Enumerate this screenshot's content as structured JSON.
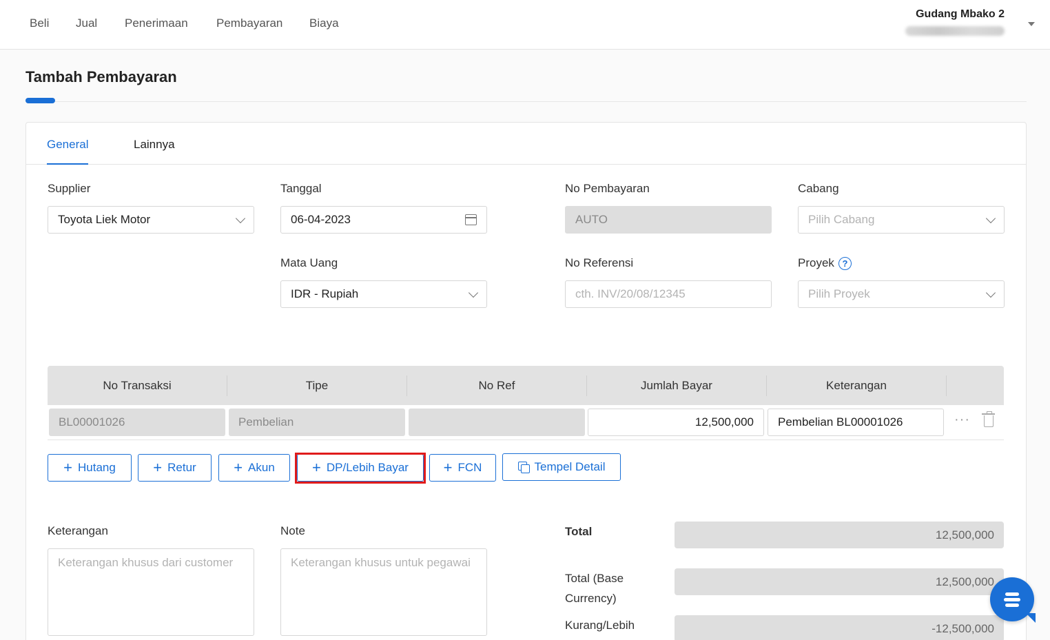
{
  "nav": {
    "items": [
      "Beli",
      "Jual",
      "Penerimaan",
      "Pembayaran",
      "Biaya"
    ]
  },
  "user": {
    "company": "Gudang Mbako 2"
  },
  "page": {
    "title": "Tambah Pembayaran"
  },
  "tabs": [
    "General",
    "Lainnya"
  ],
  "form": {
    "supplier_label": "Supplier",
    "supplier_value": "Toyota Liek Motor",
    "tanggal_label": "Tanggal",
    "tanggal_value": "06-04-2023",
    "no_pembayaran_label": "No Pembayaran",
    "no_pembayaran_value": "AUTO",
    "cabang_label": "Cabang",
    "cabang_placeholder": "Pilih Cabang",
    "mata_uang_label": "Mata Uang",
    "mata_uang_value": "IDR - Rupiah",
    "no_referensi_label": "No Referensi",
    "no_referensi_placeholder": "cth. INV/20/08/12345",
    "proyek_label": "Proyek",
    "proyek_placeholder": "Pilih Proyek"
  },
  "table": {
    "headers": [
      "No Transaksi",
      "Tipe",
      "No Ref",
      "Jumlah Bayar",
      "Keterangan"
    ],
    "rows": [
      {
        "no_transaksi": "BL00001026",
        "tipe": "Pembelian",
        "no_ref": "",
        "jumlah_bayar": "12,500,000",
        "keterangan": "Pembelian BL00001026"
      }
    ]
  },
  "actions": {
    "hutang": "Hutang",
    "retur": "Retur",
    "akun": "Akun",
    "dp": "DP/Lebih Bayar",
    "fcn": "FCN",
    "tempel": "Tempel Detail"
  },
  "notes": {
    "keterangan_label": "Keterangan",
    "keterangan_placeholder": "Keterangan khusus dari customer",
    "note_label": "Note",
    "note_placeholder": "Keterangan khusus untuk pegawai"
  },
  "summary": {
    "total_label": "Total",
    "total_value": "12,500,000",
    "total_base_label_1": "Total (Base",
    "total_base_label_2": "Currency)",
    "total_base_value": "12,500,000",
    "kurang_label": "Kurang/Lebih",
    "kurang_value": "-12,500,000"
  },
  "icons": {
    "chat": "chat-bubble-icon",
    "calendar": "calendar-icon",
    "help": "help-circle-icon"
  },
  "colors": {
    "accent": "#1a6fd6",
    "highlight": "#e01b1b"
  }
}
